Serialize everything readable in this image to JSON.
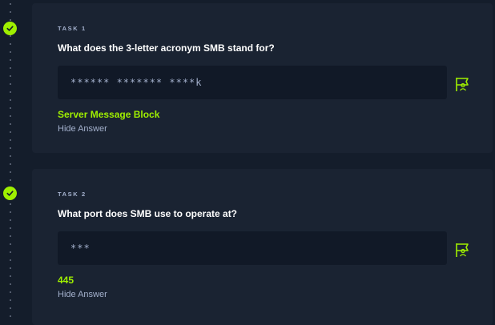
{
  "tasks": [
    {
      "label": "TASK 1",
      "question": "What does the 3-letter acronym SMB stand for?",
      "answer_mask": "****** ******* ****k",
      "answer": "Server Message Block",
      "hide_label": "Hide Answer",
      "completed": true
    },
    {
      "label": "TASK 2",
      "question": "What port does SMB use to operate at?",
      "answer_mask": "***",
      "answer": "445",
      "hide_label": "Hide Answer",
      "completed": true
    }
  ],
  "icons": {
    "completed": "check-circle-icon",
    "submit": "flag-icon"
  },
  "colors": {
    "background": "#141d2b",
    "card": "#1a2332",
    "input": "#111927",
    "accent": "#9fef00",
    "muted": "#a4b1cd"
  }
}
